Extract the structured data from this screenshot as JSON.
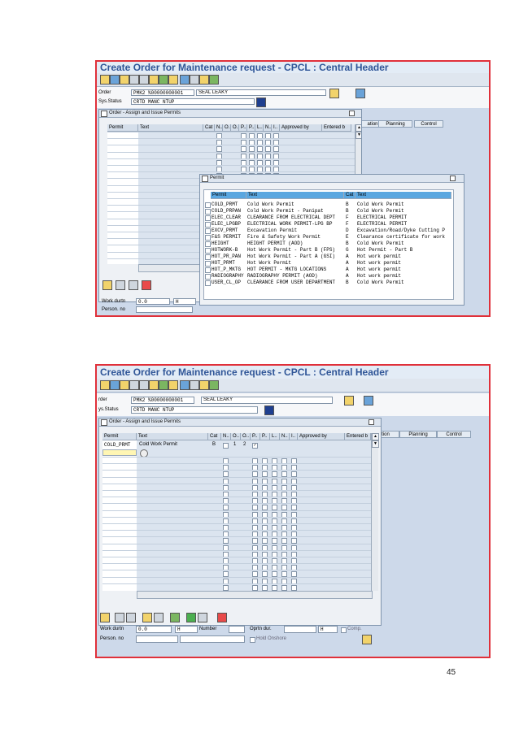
{
  "screen1": {
    "title": "Create Order for Maintenance request - CPCL : Central Header",
    "order_label": "Order",
    "order_value": "PMK2 %00000000001",
    "order_desc": "SEAL LEAKY",
    "status_label": "Sys.Status",
    "status_value": "CRTD MANC NTUP",
    "tabs": [
      "ation",
      "Planning",
      "Control"
    ],
    "permits_dialog": {
      "title": "Order - Assign and Issue Permits",
      "columns": [
        "Permit",
        "Text",
        "Cat",
        "N..",
        "O..",
        "O..",
        "P..",
        "P..",
        "L..",
        "N..",
        "I..",
        "Approved by",
        "Entered b"
      ]
    },
    "permit_dialog": {
      "title": "Permit",
      "columns": [
        "Permit",
        "Text",
        "Cat",
        "Text"
      ],
      "rows": [
        {
          "permit": "COLD_PRMT",
          "text": "Cold Work Permit",
          "cat": "B",
          "cat_text": "Cold Work Permit"
        },
        {
          "permit": "COLD_PRPAN",
          "text": "Cold Work Permit - Panipat",
          "cat": "B",
          "cat_text": "Cold Work Permit"
        },
        {
          "permit": "ELEC_CLEAR",
          "text": "CLEARANCE FROM ELECTRICAL DEPT",
          "cat": "F",
          "cat_text": "ELECTRICAL PERMIT"
        },
        {
          "permit": "ELEC_LPGBP",
          "text": "ELECTRICAL WORK PERMIT-LPG BP",
          "cat": "F",
          "cat_text": "ELECTRICAL PERMIT"
        },
        {
          "permit": "EXCV_PRMT",
          "text": "Excavation Permit",
          "cat": "D",
          "cat_text": "Excavation/Road/Dyke Cutting P"
        },
        {
          "permit": "F&S PERMIT",
          "text": "Fire & Safety Work Permit",
          "cat": "E",
          "cat_text": "Clearance certificate for work"
        },
        {
          "permit": "HEIGHT",
          "text": "HEIGHT PERMIT (AOD)",
          "cat": "B",
          "cat_text": "Cold Work Permit"
        },
        {
          "permit": "HOTWORK-B",
          "text": "Hot Work Permit - Part B (FPS)",
          "cat": "G",
          "cat_text": "Hot Permit - Part B"
        },
        {
          "permit": "HOT_PR_PAN",
          "text": "Hot Work Permit - Part A (GSI)",
          "cat": "A",
          "cat_text": "Hot work permit"
        },
        {
          "permit": "HOT_PRMT",
          "text": "Hot Work Permit",
          "cat": "A",
          "cat_text": "Hot work permit"
        },
        {
          "permit": "HOT_P_MKTG",
          "text": "HOT PERMIT - MKTG LOCATIONS",
          "cat": "A",
          "cat_text": "Hot work permit"
        },
        {
          "permit": "RADIOGRAPHY",
          "text": "RADIOGRAPHY PERMIT (AOD)",
          "cat": "A",
          "cat_text": "Hot work permit"
        },
        {
          "permit": "USER_CL_OP",
          "text": "CLEARANCE FROM USER DEPARTMENT",
          "cat": "B",
          "cat_text": "Cold Work Permit"
        }
      ]
    },
    "footer": {
      "work_label": "Work durtn",
      "work_value": "0.0",
      "work_unit": "H",
      "person_label": "Person. no"
    }
  },
  "screen2": {
    "title": "Create Order for Maintenance request - CPCL : Central Header",
    "order_label": "rder",
    "order_value": "PMK2 %00000000001",
    "order_desc": "SEAL LEAKY",
    "status_label": "ys.Status",
    "status_value": "CRTD MANC NTUP",
    "tabs": [
      "tion",
      "Planning",
      "Control"
    ],
    "permits_dialog": {
      "title": "Order - Assign and Issue Permits",
      "columns": [
        "Permit",
        "Text",
        "Cat",
        "N..",
        "O..",
        "O..",
        "P..",
        "P..",
        "L..",
        "N..",
        "I..",
        "Approved by",
        "Entered b"
      ],
      "row": {
        "permit": "COLD_PRMT",
        "text": "Cold Work Permit",
        "cat": "B",
        "o1": "1",
        "o2": "2"
      }
    },
    "footer": {
      "work_label": "Work durtn",
      "work_value": "0.0",
      "work_unit": "H",
      "number_label": "Number",
      "oprtn_label": "Oprtn dur.",
      "oprtn_unit": "H",
      "comp_label": "Comp.",
      "person_label": "Person. no",
      "hold_label": "Hold Onshore"
    }
  },
  "page_number": "45"
}
